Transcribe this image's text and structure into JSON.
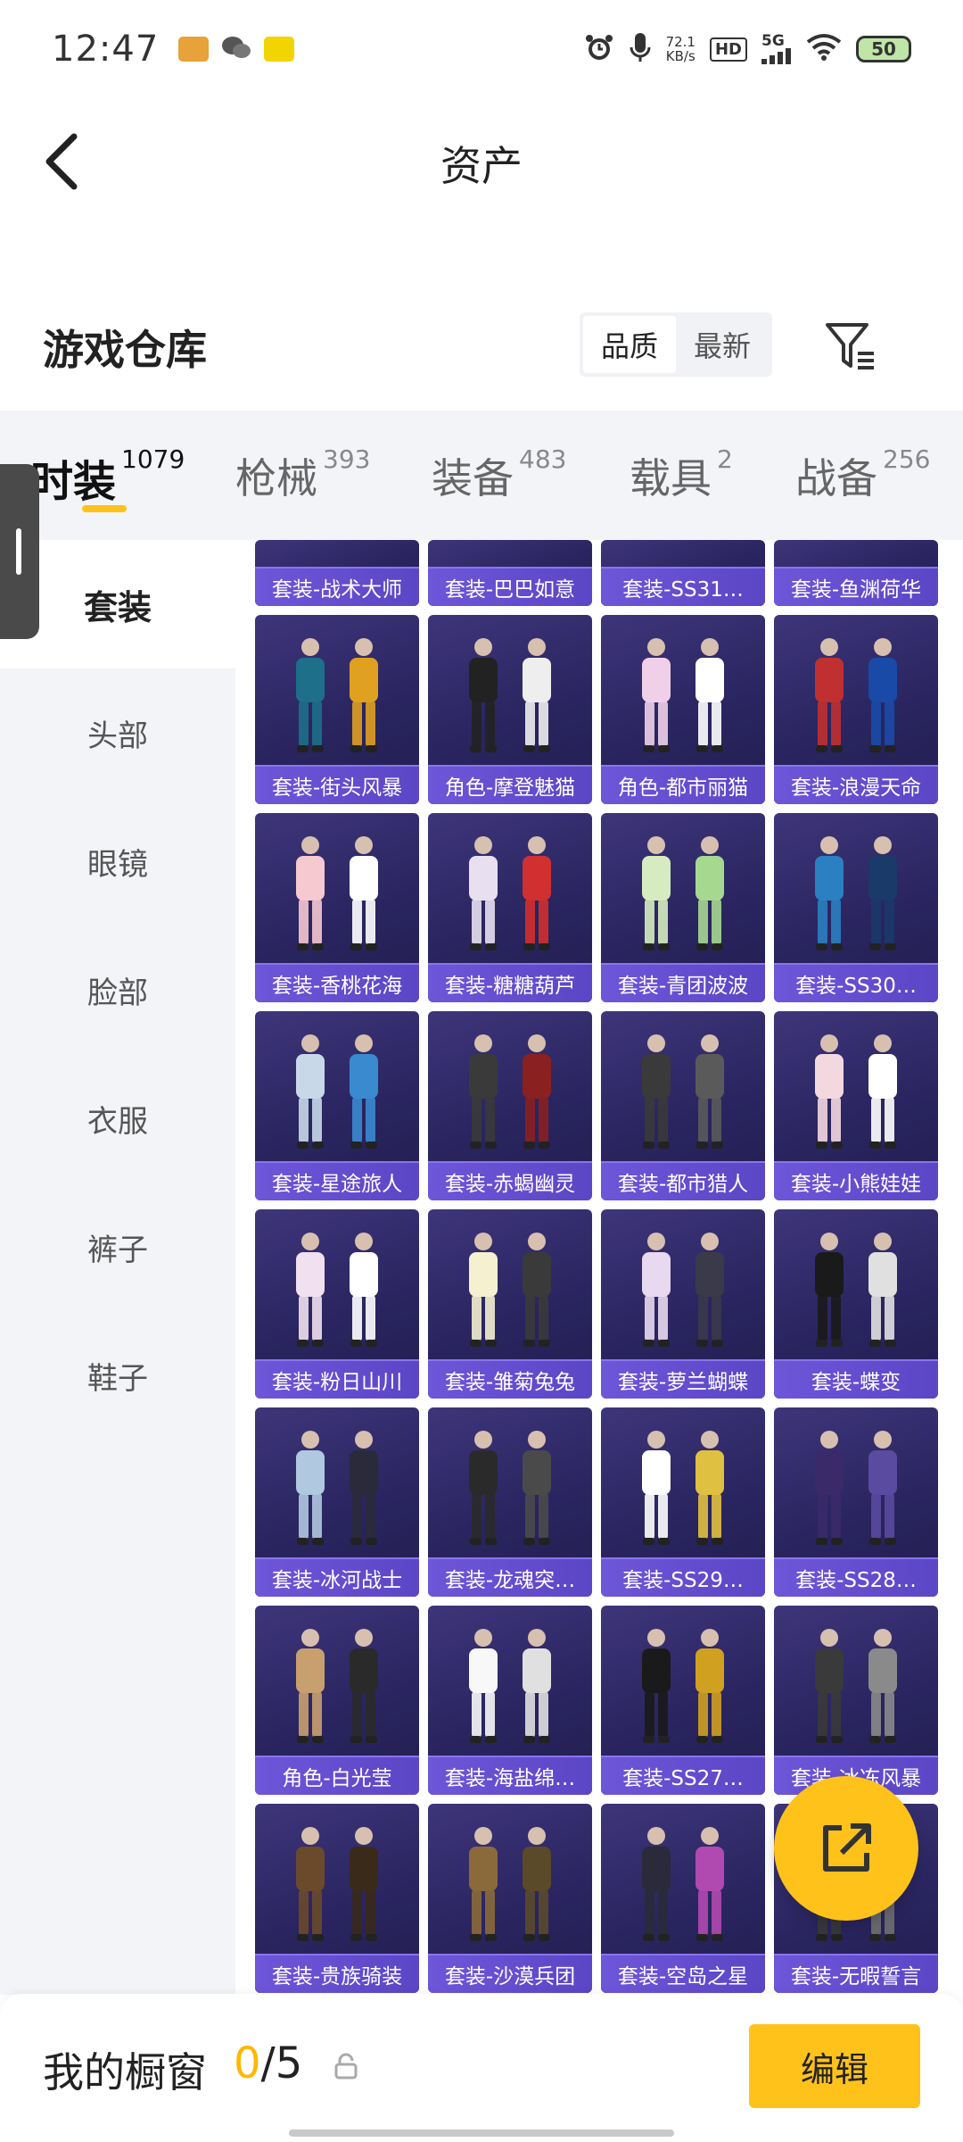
{
  "status_bar": {
    "time": "12:47",
    "net_speed_value": "72.1",
    "net_speed_unit": "KB/s",
    "hd": "HD",
    "signal": "5G",
    "battery": "50"
  },
  "header": {
    "title": "资产"
  },
  "section": {
    "title": "游戏仓库",
    "sort_options": [
      "品质",
      "最新"
    ],
    "active_sort": "品质"
  },
  "tabs": [
    {
      "label": "时装",
      "count": "1079",
      "active": true
    },
    {
      "label": "枪械",
      "count": "393"
    },
    {
      "label": "装备",
      "count": "483"
    },
    {
      "label": "载具",
      "count": "2"
    },
    {
      "label": "战备",
      "count": "256"
    }
  ],
  "sidebar": {
    "items": [
      {
        "label": "套装",
        "active": true
      },
      {
        "label": "头部"
      },
      {
        "label": "眼镜"
      },
      {
        "label": "脸部"
      },
      {
        "label": "衣服"
      },
      {
        "label": "裤子"
      },
      {
        "label": "鞋子"
      }
    ]
  },
  "grid": {
    "partial_row": [
      "套装-战术大师",
      "套装-巴巴如意",
      "套装-SS31…",
      "套装-鱼渊荷华"
    ],
    "rows": [
      [
        "套装-街头风暴",
        "角色-摩登魅猫",
        "角色-都市丽猫",
        "套装-浪漫天命"
      ],
      [
        "套装-香桃花海",
        "套装-糖糖葫芦",
        "套装-青团波波",
        "套装-SS30…"
      ],
      [
        "套装-星途旅人",
        "套装-赤蝎幽灵",
        "套装-都市猎人",
        "套装-小熊娃娃"
      ],
      [
        "套装-粉日山川",
        "套装-雏菊兔兔",
        "套装-萝兰蝴蝶",
        "套装-蝶变"
      ],
      [
        "套装-冰河战士",
        "套装-龙魂突…",
        "套装-SS29…",
        "套装-SS28…"
      ],
      [
        "角色-白光莹",
        "套装-海盐绵…",
        "套装-SS27…",
        "套装-冰冻风暴"
      ],
      [
        "套装-贵族骑装",
        "套装-沙漠兵团",
        "套装-空岛之星",
        "套装-无暇誓言"
      ]
    ]
  },
  "bottom_bar": {
    "label": "我的橱窗",
    "current": "0",
    "separator": "/",
    "max": "5",
    "edit_label": "编辑"
  },
  "colors": {
    "accent": "#ffc21a",
    "card_bg": "#2a2560",
    "card_label_bg": "#6e56d8",
    "sidebar_bg": "#f2f4f8"
  }
}
